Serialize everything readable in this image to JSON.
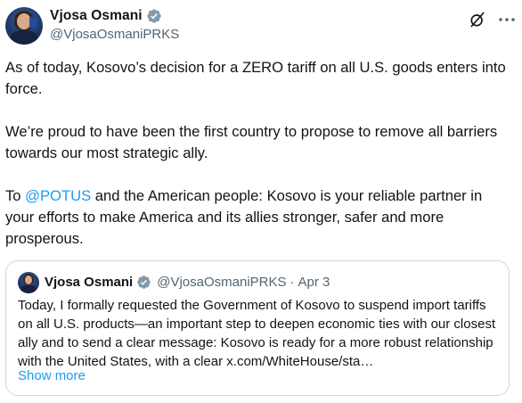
{
  "author": {
    "display_name": "Vjosa Osmani",
    "handle": "@VjosaOsmaniPRKS",
    "verified_icon": "verified-badge-icon",
    "avatar_icon": "avatar"
  },
  "header_actions": {
    "grok_icon": "grok-icon",
    "more_icon": "more-options-icon"
  },
  "tweet": {
    "paragraph_1": "As of today, Kosovo’s decision for a ZERO tariff on all U.S. goods enters into force.",
    "paragraph_2": "We’re proud to have been the first country to propose to remove all barriers towards our most strategic ally.",
    "paragraph_3_prefix": "To ",
    "paragraph_3_mention": "@POTUS",
    "paragraph_3_suffix": " and the American people: Kosovo is your reliable partner in your efforts to make America and its allies stronger, safer and more prosperous."
  },
  "quoted_tweet": {
    "display_name": "Vjosa Osmani",
    "handle": "@VjosaOsmaniPRKS",
    "separator": "·",
    "date": "Apr 3",
    "text": "Today, I formally requested the Government of Kosovo to suspend import tariffs on all U.S. products—an important step to deepen economic ties with our closest ally and to send a clear message: Kosovo is ready for a more robust relationship with the United States, with a clear ",
    "link_text": "x.com/WhiteHouse/sta…",
    "show_more": "Show more"
  },
  "colors": {
    "accent": "#1d9bf0",
    "text": "#0f1419",
    "secondary": "#536471",
    "border": "#cfd9de"
  }
}
